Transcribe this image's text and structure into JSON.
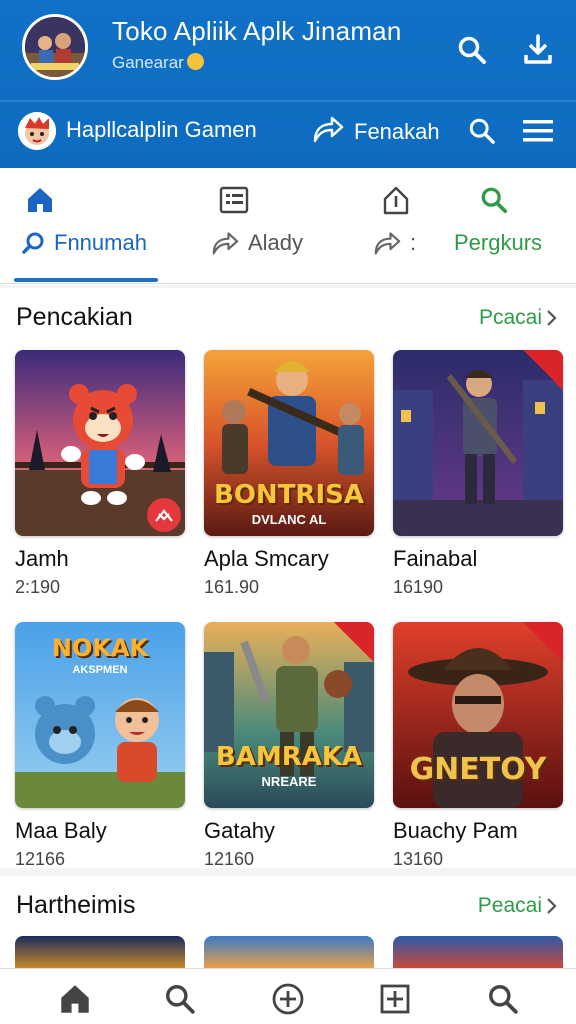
{
  "header": {
    "app_title": "Toko Apliik Aplk Jinaman",
    "app_subtitle": "Ganearar",
    "user_name": "Hapllcalplin Gamen",
    "share_label": "Fenakah"
  },
  "tabs": [
    {
      "label": "Fnnumah",
      "active": true,
      "icon": "home-icon",
      "label_icon": "search-icon"
    },
    {
      "label": "Alady",
      "active": false,
      "icon": "list-icon",
      "label_icon": "share-icon"
    },
    {
      "label": ":",
      "active": false,
      "icon": "upload-icon",
      "label_icon": "share-icon"
    },
    {
      "label": "Pergkurs",
      "active": false,
      "icon": "search-icon",
      "label_icon": ""
    }
  ],
  "sections": [
    {
      "title": "Pencakian",
      "link": "Pcacai",
      "cards": [
        {
          "name": "Jamh",
          "meta": "2:190"
        },
        {
          "name": "Apla Smcary",
          "meta": "161.90",
          "art_title": "BONTRISA",
          "art_sub": "DVLANC AL"
        },
        {
          "name": "Fainabal",
          "meta": "16190"
        },
        {
          "name": "Maa Baly",
          "meta": "12166",
          "art_title": "NOKAK",
          "art_sub": "AKSPMEN"
        },
        {
          "name": "Gatahy",
          "meta": "12160",
          "art_title": "BAMRAKA",
          "art_sub": "NREARE"
        },
        {
          "name": "Buachy Pam",
          "meta": "13160",
          "art_title": "GNETOY"
        }
      ]
    },
    {
      "title": "Hartheimis",
      "link": "Peacai"
    }
  ],
  "bottom_nav": [
    {
      "icon": "home-icon"
    },
    {
      "icon": "search-icon"
    },
    {
      "icon": "add-circle-icon"
    },
    {
      "icon": "add-box-icon"
    },
    {
      "icon": "search-icon"
    }
  ],
  "colors": {
    "header_blue": "#1071c6",
    "accent_blue": "#1a73c9",
    "link_green": "#2e9c45",
    "badge_red": "#e4383c"
  }
}
